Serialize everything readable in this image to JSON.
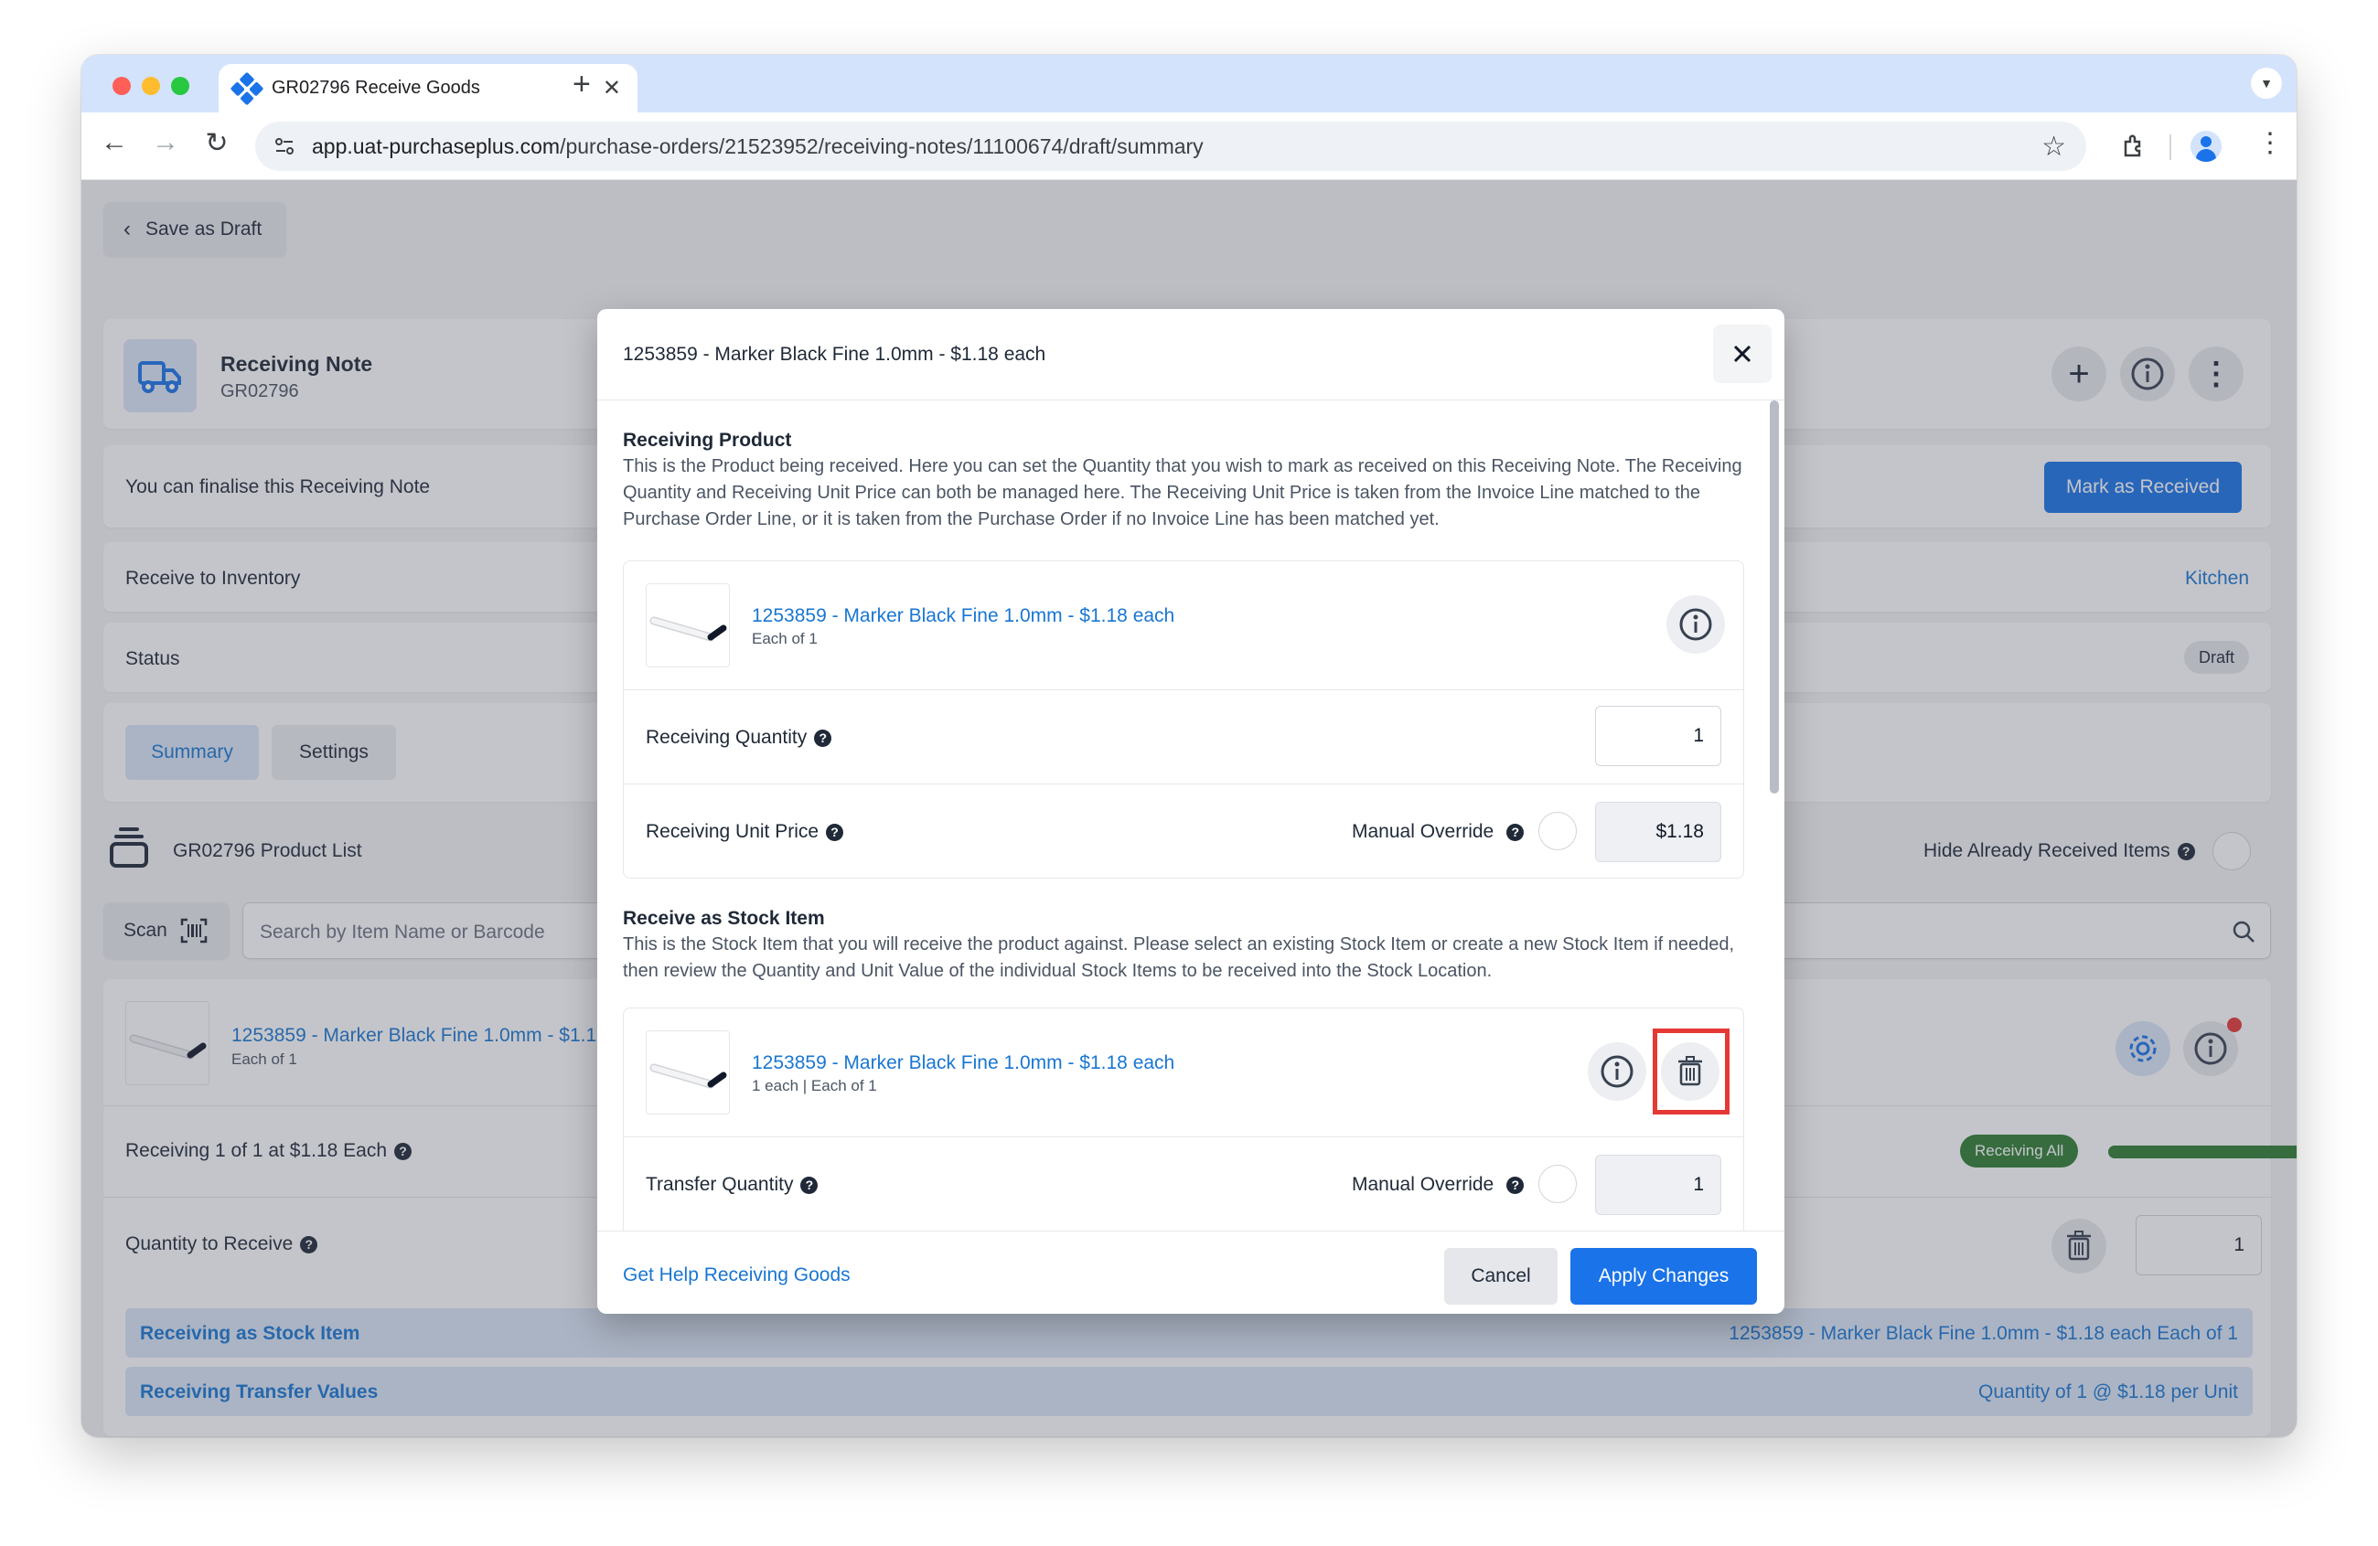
{
  "browser": {
    "tab_title": "GR02796 Receive Goods",
    "url_host": "app.uat-purchaseplus.com",
    "url_path": "/purchase-orders/21523952/receiving-notes/11100674/draft/summary"
  },
  "page": {
    "save_draft": "Save as Draft",
    "note_title": "Receiving Note",
    "note_code": "GR02796",
    "finalise_text": "You can finalise this Receiving Note",
    "mark_received": "Mark as Received",
    "receive_to_inventory": "Receive to Inventory",
    "inventory_value": "Kitchen",
    "status_label": "Status",
    "status_value": "Draft",
    "tabs": [
      "Summary",
      "Settings"
    ],
    "product_list_title": "GR02796 Product List",
    "hide_received": "Hide Already Received Items",
    "scan_label": "Scan",
    "search_placeholder": "Search by Item Name or Barcode",
    "item_name": "1253859 - Marker Black Fine 1.0mm - $1.18 each",
    "item_name_truncated": "1253859 - Marker Black Fine 1.0mm - $1.1",
    "item_unit": "Each of 1",
    "receiving_summary": "Receiving 1 of 1 at $1.18 Each",
    "receiving_badge": "Receiving All",
    "receiving_progress": 1.0,
    "qty_to_receive_label": "Quantity to Receive",
    "qty_to_receive_value": "1",
    "band1_label": "Receiving as Stock Item",
    "band1_value": "1253859 - Marker Black Fine 1.0mm - $1.18 each Each of 1",
    "band2_label": "Receiving Transfer Values",
    "band2_value": "Quantity of 1 @ $1.18 per Unit"
  },
  "modal": {
    "title": "1253859 - Marker Black Fine 1.0mm - $1.18 each",
    "section1_title": "Receiving Product",
    "section1_desc": "This is the Product being received. Here you can set the Quantity that you wish to mark as received on this Receiving Note. The Receiving Quantity and Receiving Unit Price can both be managed here. The Receiving Unit Price is taken from the Invoice Line matched to the Purchase Order Line, or it is taken from the Purchase Order if no Invoice Line has been matched yet.",
    "product_name": "1253859 - Marker Black Fine 1.0mm - $1.18 each",
    "product_unit": "Each of 1",
    "receiving_quantity_label": "Receiving Quantity",
    "receiving_quantity_value": "1",
    "receiving_price_label": "Receiving Unit Price",
    "manual_override": "Manual Override",
    "receiving_price_value": "$1.18",
    "section2_title": "Receive as Stock Item",
    "section2_desc": "This is the Stock Item that you will receive the product against. Please select an existing Stock Item or create a new Stock Item if needed, then review the Quantity and Unit Value of the individual Stock Items to be received into the Stock Location.",
    "stock_name": "1253859 - Marker Black Fine 1.0mm - $1.18 each",
    "stock_unit": "1 each | Each of 1",
    "transfer_quantity_label": "Transfer Quantity",
    "transfer_quantity_value": "1",
    "help_link": "Get Help Receiving Goods",
    "cancel": "Cancel",
    "apply": "Apply Changes"
  },
  "colors": {
    "accent": "#1a73e8",
    "link": "#1976d2",
    "success": "#2e7d32",
    "highlight": "#e53935"
  }
}
